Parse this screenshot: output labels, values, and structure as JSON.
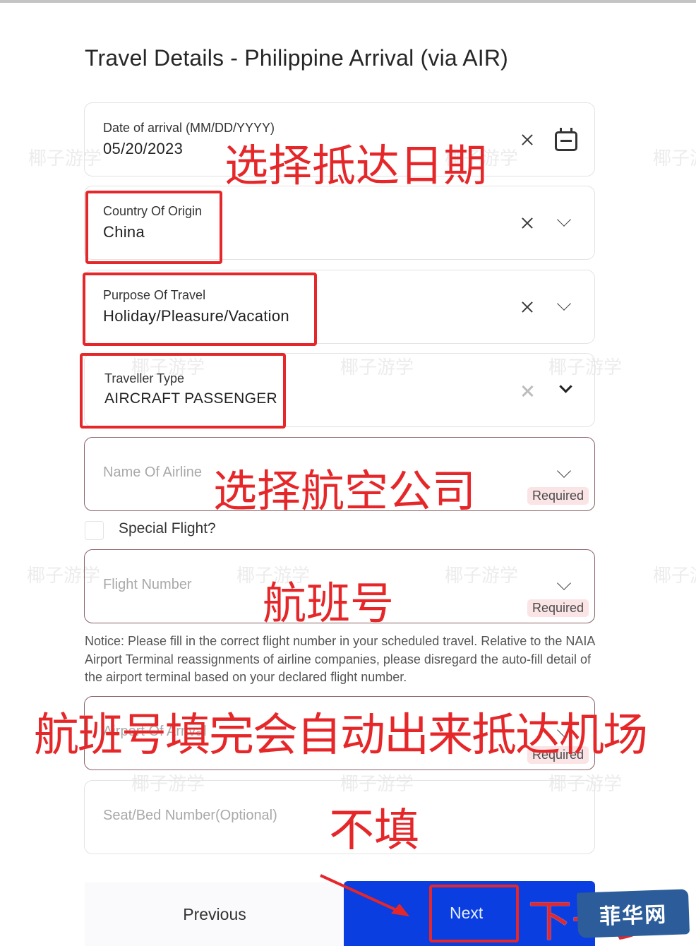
{
  "page": {
    "title": "Travel Details - Philippine Arrival (via AIR)"
  },
  "fields": {
    "arrival_date": {
      "label": "Date of arrival (MM/DD/YYYY)",
      "value": "05/20/2023",
      "icons": [
        "clear-icon",
        "calendar-icon"
      ]
    },
    "country_of_origin": {
      "label": "Country Of Origin",
      "value": "China",
      "icons": [
        "clear-icon",
        "chevron-down-icon"
      ]
    },
    "purpose_of_travel": {
      "label": "Purpose Of Travel",
      "value": "Holiday/Pleasure/Vacation",
      "icons": [
        "clear-icon",
        "chevron-down-icon"
      ]
    },
    "traveller_type": {
      "label": "Traveller Type",
      "value": "AIRCRAFT PASSENGER",
      "icons": [
        "clear-icon",
        "chevron-down-icon"
      ]
    },
    "airline_name": {
      "placeholder": "Name Of Airline",
      "badge": "Required"
    },
    "special_flight": {
      "label": "Special Flight?",
      "checked": false
    },
    "flight_number": {
      "placeholder": "Flight Number",
      "badge": "Required"
    },
    "airport_of_arrival": {
      "placeholder": "Airport Of Arrival",
      "badge": "Required"
    },
    "seat_number": {
      "placeholder": "Seat/Bed Number(Optional)"
    }
  },
  "notice": "Notice: Please fill in the correct flight number in your scheduled travel. Relative to the NAIA Airport Terminal reassignments of airline companies, please disregard the auto-fill detail of the airport terminal based on your declared flight number.",
  "buttons": {
    "previous": "Previous",
    "next": "Next"
  },
  "annotations": {
    "select_arrival_date": "选择抵达日期",
    "select_airline": "选择航空公司",
    "flight_number": "航班号",
    "airport_autofill": "航班号填完会自动出来抵达机场",
    "leave_blank": "不填",
    "next_step": "下一步"
  },
  "watermark": {
    "text": "椰子游学",
    "logo": "菲华网"
  },
  "colors": {
    "primary_button": "#0a3ee0",
    "annotation_red": "#e5272a",
    "required_badge_bg": "#fbe4e6",
    "error_border": "#8a6266",
    "logo_bg": "#2c5d9a"
  }
}
